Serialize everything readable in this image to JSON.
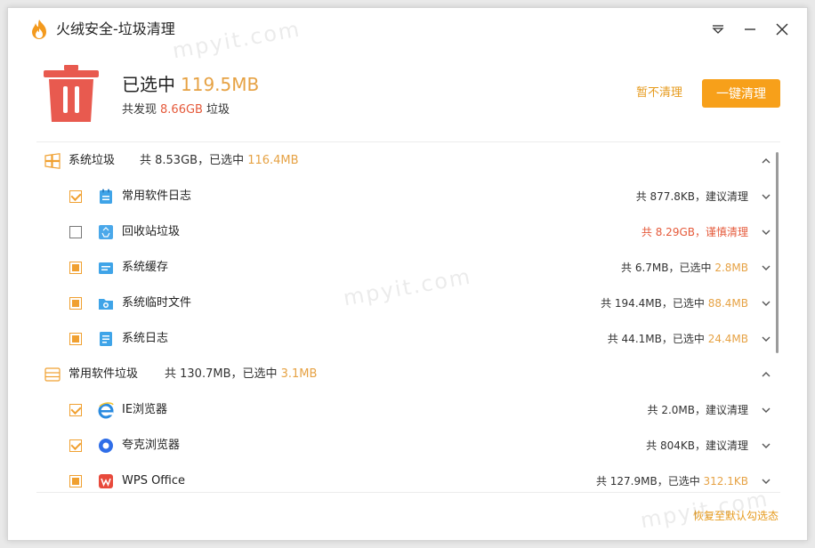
{
  "window": {
    "title": "火绒安全-垃圾清理"
  },
  "summary": {
    "selected_label": "已选中",
    "selected_size": "119.5MB",
    "found_prefix": "共发现",
    "found_size": "8.66GB",
    "found_suffix": "垃圾",
    "skip_label": "暂不清理",
    "clean_label": "一键清理"
  },
  "groups": [
    {
      "name": "系统垃圾",
      "stats_prefix": "共 8.53GB，已选中",
      "stats_selected": "116.4MB",
      "items": [
        {
          "name": "常用软件日志",
          "check": "checked",
          "stats": "共 877.8KB，建议清理",
          "stats_selected": ""
        },
        {
          "name": "回收站垃圾",
          "check": "unchecked",
          "stats": "共 8.29GB，谨慎清理",
          "stats_selected": "",
          "warn": true
        },
        {
          "name": "系统缓存",
          "check": "partial",
          "stats": "共 6.7MB，已选中",
          "stats_selected": "2.8MB"
        },
        {
          "name": "系统临时文件",
          "check": "partial",
          "stats": "共 194.4MB，已选中",
          "stats_selected": "88.4MB"
        },
        {
          "name": "系统日志",
          "check": "partial",
          "stats": "共 44.1MB，已选中",
          "stats_selected": "24.4MB"
        }
      ]
    },
    {
      "name": "常用软件垃圾",
      "stats_prefix": "共 130.7MB，已选中",
      "stats_selected": "3.1MB",
      "items": [
        {
          "name": "IE浏览器",
          "check": "checked",
          "stats": "共 2.0MB，建议清理",
          "stats_selected": ""
        },
        {
          "name": "夸克浏览器",
          "check": "checked",
          "stats": "共 804KB，建议清理",
          "stats_selected": ""
        },
        {
          "name": "WPS Office",
          "check": "partial",
          "stats": "共 127.9MB，已选中",
          "stats_selected": "312.1KB"
        }
      ]
    }
  ],
  "footer": {
    "restore_label": "恢复至默认勾选态"
  },
  "watermark": "mpyit.com",
  "colors": {
    "accent": "#f7a01a",
    "selected_size": "#e6a244",
    "warning": "#e55a3b",
    "trash": "#e85a4f"
  }
}
